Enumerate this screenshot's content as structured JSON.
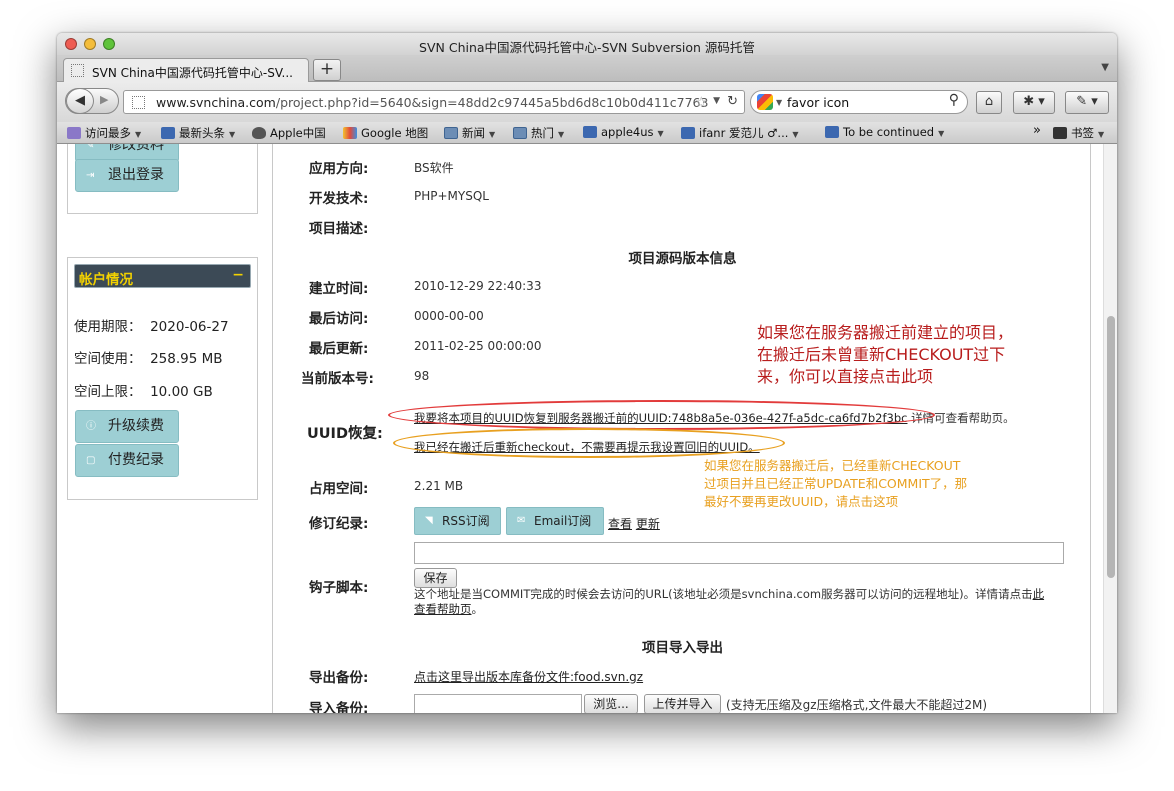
{
  "window": {
    "title": "SVN China中国源代码托管中心-SVN Subversion 源码托管"
  },
  "tabs": [
    {
      "label": "SVN China中国源代码托管中心-SV..."
    }
  ],
  "new_tab_label": "+",
  "toolbar": {
    "url_host": "www.svnchina.com",
    "url_path": "/project.php?id=5640&sign=48dd2c97445a5bd6d8c10b0d411c7763",
    "search_text": "favor icon"
  },
  "bookmarks": [
    {
      "label": "访问最多",
      "icon": "gear-icon",
      "menu": true
    },
    {
      "label": "最新头条",
      "icon": "rss-icon",
      "menu": true
    },
    {
      "label": "Apple中国",
      "icon": "apple-icon",
      "menu": false
    },
    {
      "label": "Google 地图",
      "icon": "google-maps-icon",
      "menu": false
    },
    {
      "label": "新闻",
      "icon": "folder-icon",
      "menu": true
    },
    {
      "label": "热门",
      "icon": "folder-icon",
      "menu": true
    },
    {
      "label": "apple4us",
      "icon": "rss-icon",
      "menu": true
    },
    {
      "label": "ifanr 爱范儿 ♂...",
      "icon": "rss-icon",
      "menu": true
    },
    {
      "label": "To be continued",
      "icon": "rss-icon",
      "menu": true
    }
  ],
  "bookmarks_overflow": "»",
  "bookmarks_menu": "书签",
  "sidebar": {
    "partial_button": "修改资料",
    "logout_button": "退出登录",
    "account_title": "帐户情况",
    "minimize": "−",
    "rows": [
      {
        "label": "使用期限：",
        "value": "2020-06-27"
      },
      {
        "label": "空间使用：",
        "value": "258.95 MB"
      },
      {
        "label": "空间上限：",
        "value": "10.00 GB"
      }
    ],
    "upgrade_button": "升级续费",
    "payment_button": "付费纪录"
  },
  "project": {
    "direction_label": "应用方向:",
    "direction_value": "BS软件",
    "tech_label": "开发技术:",
    "tech_value": "PHP+MYSQL",
    "desc_label": "项目描述:",
    "version_section": "项目源码版本信息",
    "created_label": "建立时间:",
    "created_value": "2010-12-29 22:40:33",
    "last_access_label": "最后访问:",
    "last_access_value": "0000-00-00",
    "last_update_label": "最后更新:",
    "last_update_value": "2011-02-25 00:00:00",
    "revision_label": "当前版本号:",
    "revision_value": "98",
    "uuid_label": "UUID恢复:",
    "uuid_restore_link": "我要将本项目的UUID恢复到服务器搬迁前的UUID:748b8a5e-036e-427f-a5dc-ca6fd7b2f3bc",
    "uuid_restore_suffix": " 详情可查看帮助页。",
    "uuid_ignore_link": "我已经在搬迁后重新checkout，不需要再提示我设置回旧的UUID。",
    "space_label": "占用空间:",
    "space_value": "2.21 MB",
    "rev_log_label": "修订纪录:",
    "rss_button": "RSS订阅",
    "email_button": "Email订阅",
    "view_link": "查看",
    "update_link": "更新",
    "hook_label": "钩子脚本:",
    "save_button": "保存",
    "hook_note": "这个地址是当COMMIT完成的时候会去访问的URL(该地址必须是svnchina.com服务器可以访问的远程地址)。详情请点击",
    "hook_note_link1": "此",
    "hook_note_link2": "查看帮助页",
    "hook_note_end": "。",
    "import_section": "项目导入导出",
    "export_label": "导出备份:",
    "export_link": "点击这里导出版本库备份文件:food.svn.gz",
    "import_label": "导入备份:",
    "browse_button": "浏览...",
    "upload_button": "上传并导入",
    "import_note": "(支持无压缩及gz压缩格式,文件最大不能超过2M)"
  },
  "annotations": {
    "red": [
      "如果您在服务器搬迁前建立的项目，",
      "在搬迁后未曾重新CHECKOUT过下",
      "来，你可以直接点击此项"
    ],
    "orange": [
      "如果您在服务器搬迁后，已经重新CHECKOUT",
      "过项目并且已经正常UPDATE和COMMIT了，那",
      "最好不要再更改UUID，请点击这项"
    ]
  },
  "colors": {
    "accent_button": "#9dcfd4",
    "annotation_red": "#b81d1d",
    "annotation_orange": "#e8a020",
    "account_header_bg": "#3c4a56",
    "account_header_text": "#f2d100"
  }
}
